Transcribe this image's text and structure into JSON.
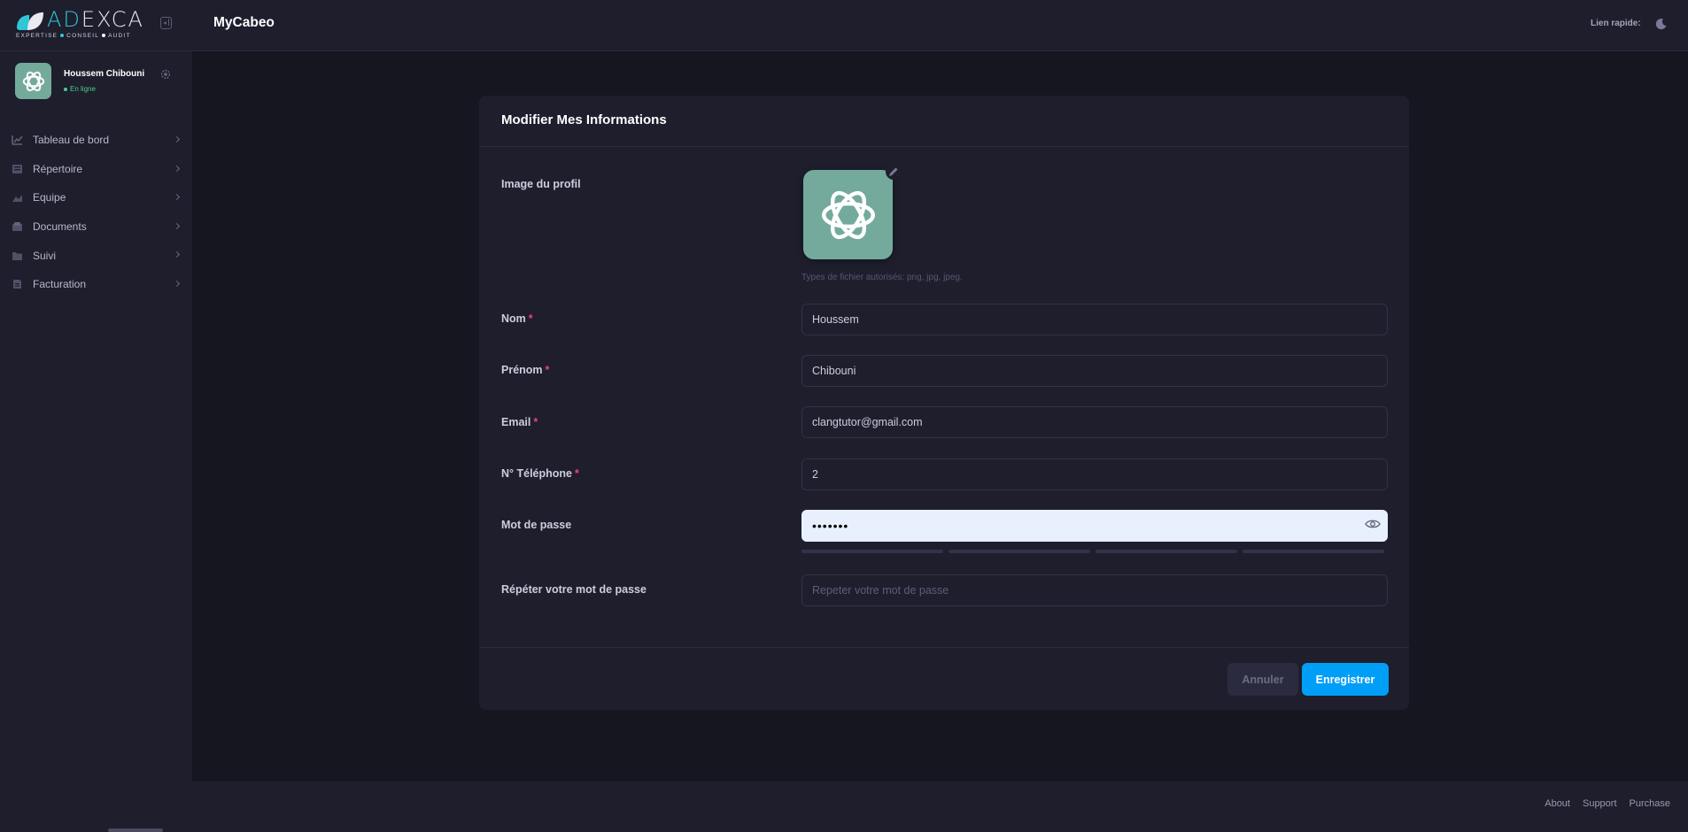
{
  "brand": {
    "logo_text_left": "AD",
    "logo_text_right": "EXCA",
    "tagline_parts": [
      "EXPERTISE",
      "CONSEIL",
      "AUDIT"
    ],
    "accent_color": "#2fc7d6"
  },
  "header": {
    "title": "MyCabeo",
    "quick_link": "Lien rapide:"
  },
  "user": {
    "name": "Houssem Chibouni",
    "status": "En ligne",
    "status_color": "#50cd89"
  },
  "sidebar": {
    "items": [
      {
        "label": "Tableau de bord",
        "icon": "chart-icon"
      },
      {
        "label": "Répertoire",
        "icon": "directory-icon"
      },
      {
        "label": "Equipe",
        "icon": "team-icon"
      },
      {
        "label": "Documents",
        "icon": "documents-icon"
      },
      {
        "label": "Suivi",
        "icon": "folder-icon"
      },
      {
        "label": "Facturation",
        "icon": "invoice-icon"
      }
    ]
  },
  "form": {
    "title": "Modifier Mes Informations",
    "profile_image_label": "Image du profil",
    "file_hint": "Types de fichier autorisés: png, jpg, jpeg.",
    "fields": {
      "nom": {
        "label": "Nom",
        "value": "Houssem"
      },
      "prenom": {
        "label": "Prénom",
        "value": "Chibouni"
      },
      "email": {
        "label": "Email",
        "value": "clangtutor@gmail.com"
      },
      "phone": {
        "label": "N° Téléphone",
        "value": "2"
      },
      "password": {
        "label": "Mot de passe",
        "value": "•••••••"
      },
      "repeat": {
        "label": "Répéter votre mot de passe",
        "placeholder": "Repeter votre mot de passe"
      }
    },
    "required_mark": "*",
    "cancel_label": "Annuler",
    "save_label": "Enregistrer",
    "primary_color": "#009ef7"
  },
  "footer": {
    "links": [
      "About",
      "Support",
      "Purchase"
    ]
  }
}
